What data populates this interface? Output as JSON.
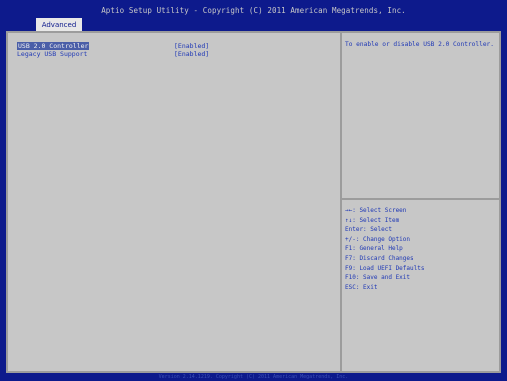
{
  "header": {
    "title": "Aptio Setup Utility - Copyright (C) 2011 American Megatrends, Inc.",
    "active_tab": "Advanced"
  },
  "settings": [
    {
      "label": "USB 2.0 Controller",
      "value": "[Enabled]",
      "selected": true
    },
    {
      "label": "Legacy USB Support",
      "value": "[Enabled]",
      "selected": false
    }
  ],
  "help": {
    "text": "To enable or disable USB 2.0 Controller."
  },
  "keys": [
    "→←: Select Screen",
    "↑↓: Select Item",
    "Enter: Select",
    "+/-: Change Option",
    "F1: General Help",
    "F7: Discard Changes",
    "F9: Load UEFI Defaults",
    "F10: Save and Exit",
    "ESC: Exit"
  ],
  "footer": {
    "text": "Version 2.14.1219. Copyright (C) 2011 American Megatrends, Inc."
  },
  "colors": {
    "background": "#0d1a8c",
    "panel": "#c7c7c7",
    "text": "#1f38b5",
    "selected_highlight": "#4a5ea8"
  }
}
